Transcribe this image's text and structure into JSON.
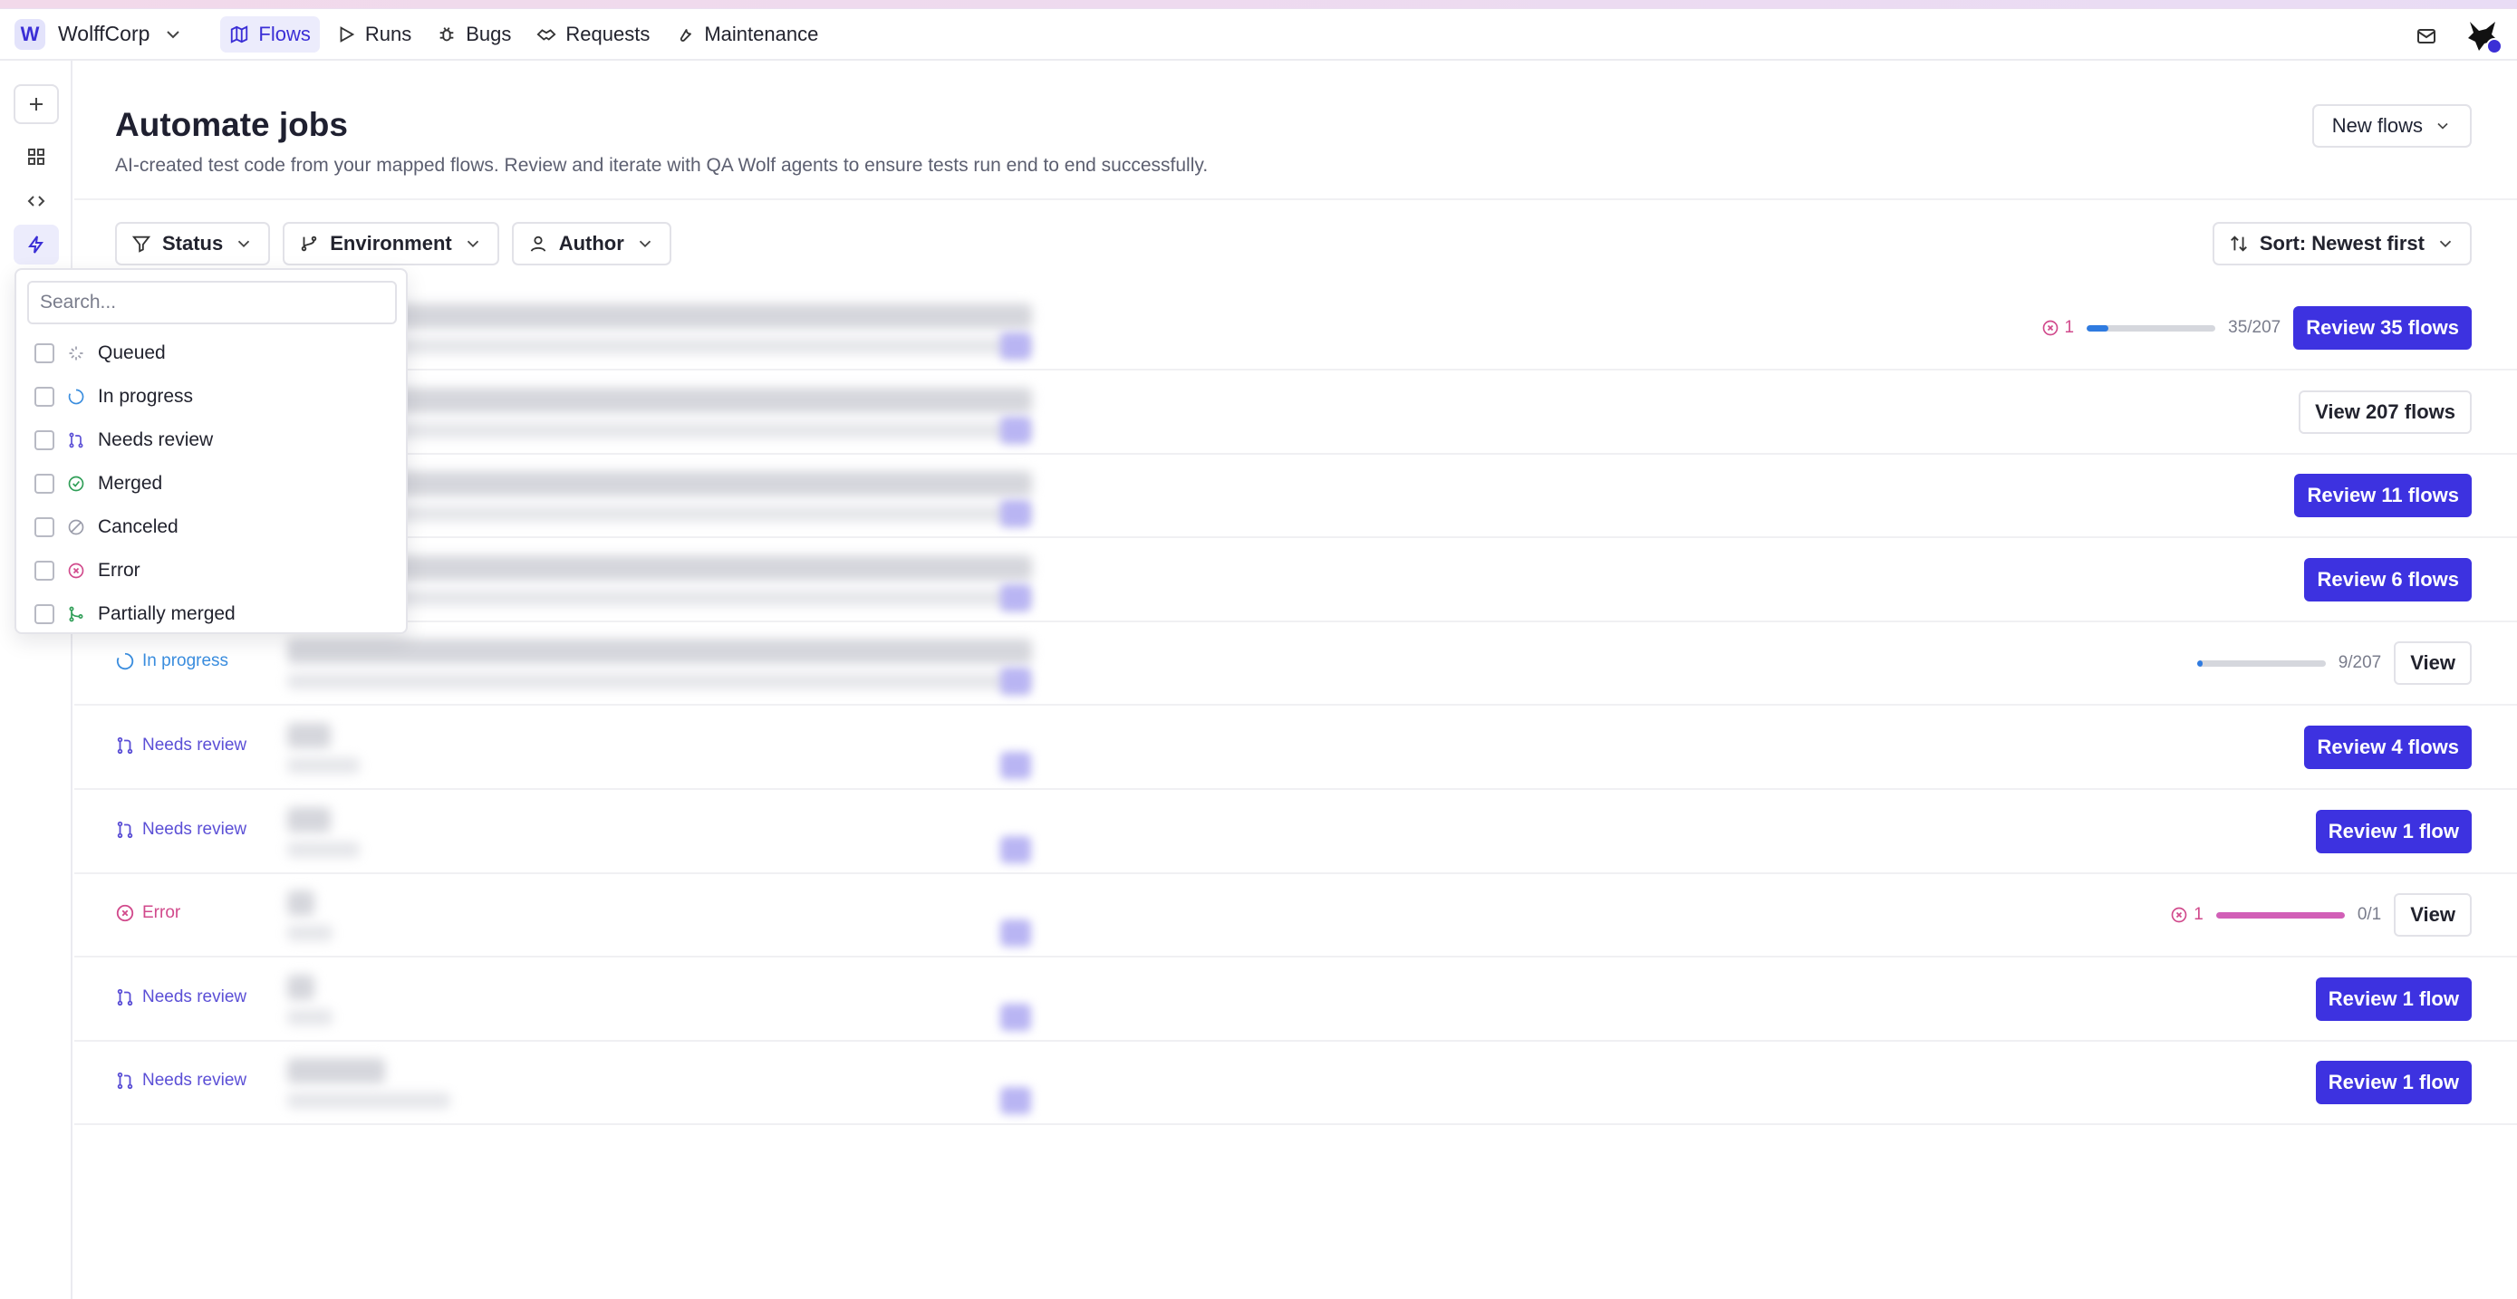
{
  "workspace": {
    "initial": "W",
    "name": "WolffCorp"
  },
  "nav": [
    {
      "label": "Flows",
      "icon": "map-icon",
      "active": true
    },
    {
      "label": "Runs",
      "icon": "play-icon",
      "active": false
    },
    {
      "label": "Bugs",
      "icon": "bug-icon",
      "active": false
    },
    {
      "label": "Requests",
      "icon": "handshake-icon",
      "active": false
    },
    {
      "label": "Maintenance",
      "icon": "wrench-icon",
      "active": false
    }
  ],
  "page": {
    "title": "Automate jobs",
    "subtitle": "AI-created test code from your mapped flows. Review and iterate with QA Wolf agents to ensure tests run end to end successfully.",
    "new_flows_label": "New flows"
  },
  "filters": {
    "status": "Status",
    "environment": "Environment",
    "author": "Author",
    "sort": "Sort: Newest first"
  },
  "status_popover": {
    "search_placeholder": "Search...",
    "options": [
      {
        "label": "Queued",
        "icon": "queued-icon",
        "color": "#9a9caa"
      },
      {
        "label": "In progress",
        "icon": "spinner-icon",
        "color": "#3a8dde"
      },
      {
        "label": "Needs review",
        "icon": "git-pull-request-icon",
        "color": "#5b4fd6"
      },
      {
        "label": "Merged",
        "icon": "check-circle-icon",
        "color": "#2f9e57"
      },
      {
        "label": "Canceled",
        "icon": "slash-circle-icon",
        "color": "#9a9caa"
      },
      {
        "label": "Error",
        "icon": "x-circle-icon",
        "color": "#d14a8c"
      },
      {
        "label": "Partially merged",
        "icon": "git-merge-icon",
        "color": "#2f9e57"
      }
    ]
  },
  "rows": [
    {
      "status": "",
      "error_count": "1",
      "progress": 0.169,
      "ratio": "35/207",
      "action": "Review 35 flows",
      "primary": true
    },
    {
      "status": "",
      "action": "View 207 flows",
      "primary": false
    },
    {
      "status": "",
      "action": "Review 11 flows",
      "primary": true
    },
    {
      "status": "",
      "action": "Review 6 flows",
      "primary": true
    },
    {
      "status": "In progress",
      "status_color": "#3a8dde",
      "progress": 0.043,
      "ratio": "9/207",
      "action": "View",
      "primary": false
    },
    {
      "status": "Needs review",
      "status_color": "#5b4fd6",
      "action": "Review 4 flows",
      "primary": true
    },
    {
      "status": "Needs review",
      "status_color": "#5b4fd6",
      "action": "Review 1 flow",
      "primary": true
    },
    {
      "status": "Error",
      "status_color": "#d14a8c",
      "error_count": "1",
      "progress": 1.0,
      "ratio": "0/1",
      "action": "View",
      "primary": false
    },
    {
      "status": "Needs review",
      "status_color": "#5b4fd6",
      "action": "Review 1 flow",
      "primary": true
    },
    {
      "status": "Needs review",
      "status_color": "#5b4fd6",
      "action": "Review 1 flow",
      "primary": true
    }
  ],
  "colors": {
    "accent": "#3d32e0",
    "in_progress": "#3a8dde",
    "needs_review": "#5b4fd6",
    "error": "#d14a8c",
    "progress_blue": "#2f7be0",
    "progress_error": "#d25fb7"
  }
}
